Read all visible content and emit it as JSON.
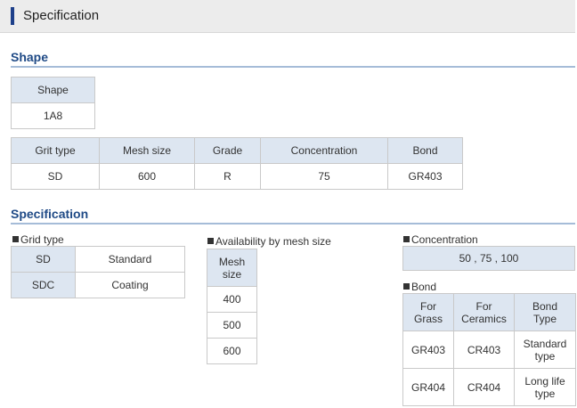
{
  "header": {
    "title": "Specification"
  },
  "shape_section": {
    "title": "Shape",
    "shape_table": {
      "header": "Shape",
      "value": "1A8"
    },
    "spec_table": {
      "headers": [
        "Grit type",
        "Mesh size",
        "Grade",
        "Concentration",
        "Bond"
      ],
      "row": [
        "SD",
        "600",
        "R",
        "75",
        "GR403"
      ]
    }
  },
  "spec_section": {
    "title": "Specification",
    "grid_type": {
      "label": "Grid type",
      "rows": [
        {
          "code": "SD",
          "desc": "Standard"
        },
        {
          "code": "SDC",
          "desc": "Coating"
        }
      ]
    },
    "mesh": {
      "label": "Availability by mesh size",
      "header_line1": "Mesh",
      "header_line2": "size",
      "values": [
        "400",
        "500",
        "600"
      ]
    },
    "concentration": {
      "label": "Concentration",
      "value": "50 , 75 , 100"
    },
    "bond": {
      "label": "Bond",
      "headers": [
        {
          "l1": "For",
          "l2": "Grass"
        },
        {
          "l1": "For",
          "l2": "Ceramics"
        },
        {
          "l1": "Bond",
          "l2": "Type"
        }
      ],
      "rows": [
        {
          "grass": "GR403",
          "ceramics": "CR403",
          "type_l1": "Standard",
          "type_l2": "type"
        },
        {
          "grass": "GR404",
          "ceramics": "CR404",
          "type_l1": "Long life",
          "type_l2": "type"
        }
      ]
    }
  },
  "colors": {
    "accent": "#1d3f8a",
    "heading": "#1f4a86",
    "table_header_bg": "#dde6f1",
    "rule": "#a5bcd8"
  }
}
